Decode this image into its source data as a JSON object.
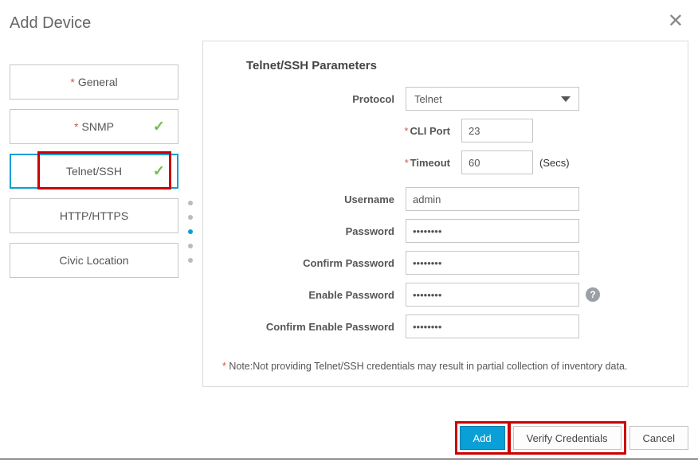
{
  "dialog": {
    "title": "Add Device"
  },
  "tabs": {
    "general": "General",
    "snmp": "SNMP",
    "telnetssh": "Telnet/SSH",
    "http": "HTTP/HTTPS",
    "civic": "Civic Location"
  },
  "panel": {
    "title": "Telnet/SSH Parameters",
    "labels": {
      "protocol": "Protocol",
      "cli_port": "CLI Port",
      "timeout": "Timeout",
      "secs": "(Secs)",
      "username": "Username",
      "password": "Password",
      "confirm_password": "Confirm Password",
      "enable_password": "Enable Password",
      "confirm_enable_password": "Confirm Enable Password"
    },
    "values": {
      "protocol": "Telnet",
      "cli_port": "23",
      "timeout": "60",
      "username": "admin",
      "password": "••••••••",
      "confirm_password": "••••••••",
      "enable_password": "••••••••",
      "confirm_enable_password": "••••••••"
    },
    "note_prefix": "* ",
    "note": "Note:Not providing Telnet/SSH credentials may result in partial collection of inventory data."
  },
  "buttons": {
    "add": "Add",
    "verify": "Verify Credentials",
    "cancel": "Cancel"
  }
}
